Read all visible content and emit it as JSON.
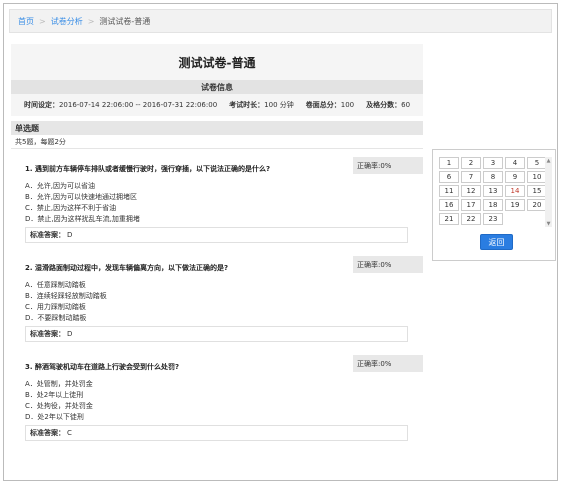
{
  "breadcrumb": {
    "home": "首页",
    "parent": "试卷分析",
    "current": "测试试卷-普通",
    "separator": ">"
  },
  "paper": {
    "title": "测试试卷-普通",
    "info_header": "试卷信息",
    "time_label": "时间设定：",
    "time_value": "2016-07-14 22:06:00 -- 2016-07-31 22:06:00",
    "duration_label": "考试时长：",
    "duration_value": "100 分钟",
    "total_label": "卷面总分：",
    "total_value": "100",
    "pass_label": "及格分数：",
    "pass_value": "60"
  },
  "section": {
    "title": "单选题",
    "summary": "共5题，每题2分"
  },
  "questions": [
    {
      "title": "1. 遇到前方车辆停车排队或者缓慢行驶时，强行穿插，以下说法正确的是什么?",
      "rate": "正确率:0%",
      "options": [
        "A．允许,因为可以省油",
        "B．允许,因为可以快速地通过拥堵区",
        "C．禁止,因为这样不利于省油",
        "D．禁止,因为这样扰乱车流,加重拥堵"
      ],
      "answer_label": "标准答案：",
      "answer": "D"
    },
    {
      "title": "2. 湿滑路面制动过程中，发现车辆偏离方向，以下做法正确的是?",
      "rate": "正确率:0%",
      "options": [
        "A．任意踩制动踏板",
        "B．连续轻踩轻放制动踏板",
        "C．用力踩制动踏板",
        "D．不要踩制动踏板"
      ],
      "answer_label": "标准答案：",
      "answer": "D"
    },
    {
      "title": "3. 醉酒驾驶机动车在道路上行驶会受到什么处罚?",
      "rate": "正确率:0%",
      "options": [
        "A．处管制，并处罚金",
        "B．处2年以上徒刑",
        "C．处拘役，并处罚金",
        "D．处2年以下徒刑"
      ],
      "answer_label": "标准答案：",
      "answer": "C"
    }
  ],
  "nav": {
    "numbers": [
      "1",
      "2",
      "3",
      "4",
      "5",
      "6",
      "7",
      "8",
      "9",
      "10",
      "11",
      "12",
      "13",
      "14",
      "15",
      "16",
      "17",
      "18",
      "19",
      "20",
      "21",
      "22",
      "23"
    ],
    "highlighted": [
      "14"
    ],
    "back_label": "返回",
    "scroll_up": "▲",
    "scroll_down": "▼"
  }
}
